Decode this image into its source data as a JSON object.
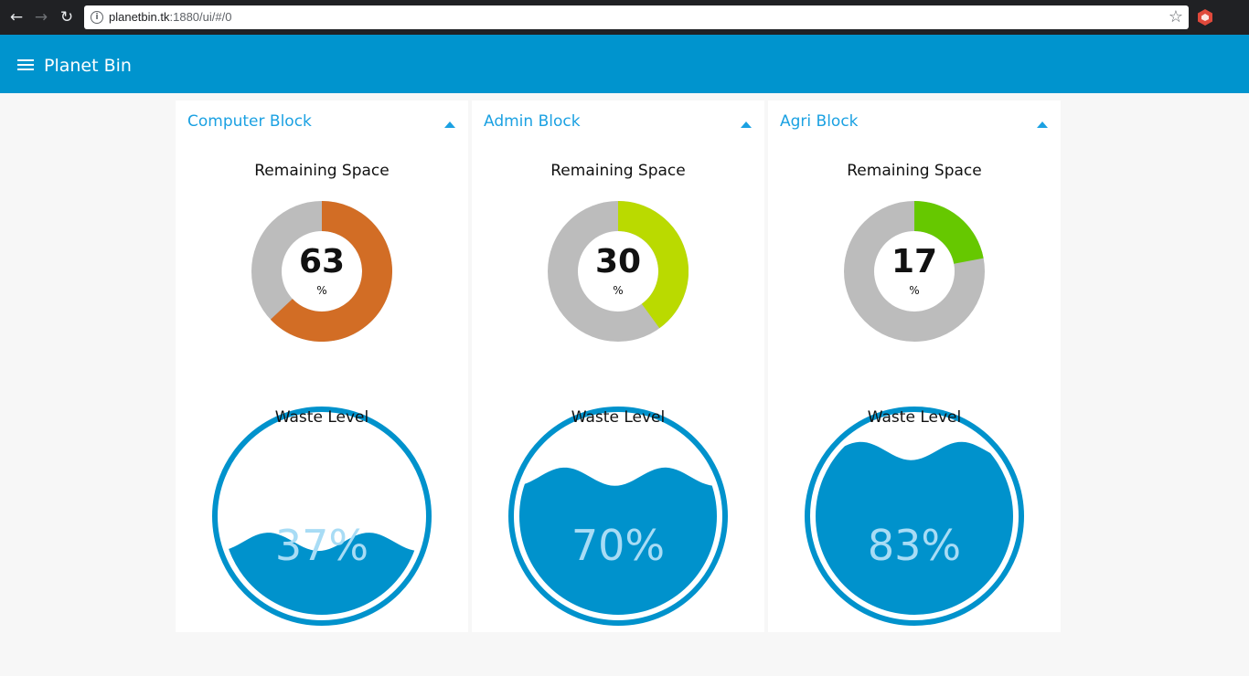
{
  "browser": {
    "back_icon": "arrow-left-icon",
    "forward_icon": "arrow-right-icon",
    "reload_icon": "reload-icon",
    "url_host": "planetbin.tk",
    "url_rest": ":1880/ui/#/0",
    "bookmark_icon": "star-icon"
  },
  "app": {
    "menu_icon": "hamburger-menu-icon",
    "title": "Planet Bin"
  },
  "colors": {
    "toolbar": "#0094ce",
    "accent": "#1ba1e2",
    "liquid": "#0092cc",
    "gauge_track": "#bcbcbc"
  },
  "cards": [
    {
      "title": "Computer Block",
      "gauge_label": "Remaining Space",
      "gauge_value": "63",
      "gauge_unit": "%",
      "gauge_percent": 63,
      "gauge_color": "#d26d25",
      "waste_label": "Waste Level",
      "waste_text": "37%",
      "waste_percent": 37
    },
    {
      "title": "Admin Block",
      "gauge_label": "Remaining Space",
      "gauge_value": "30",
      "gauge_unit": "%",
      "gauge_percent": 40,
      "gauge_color": "#bada00",
      "waste_label": "Waste Level",
      "waste_text": "70%",
      "waste_percent": 70
    },
    {
      "title": "Agri Block",
      "gauge_label": "Remaining Space",
      "gauge_value": "17",
      "gauge_unit": "%",
      "gauge_percent": 22,
      "gauge_color": "#66c800",
      "waste_label": "Waste Level",
      "waste_text": "83%",
      "waste_percent": 83
    }
  ]
}
